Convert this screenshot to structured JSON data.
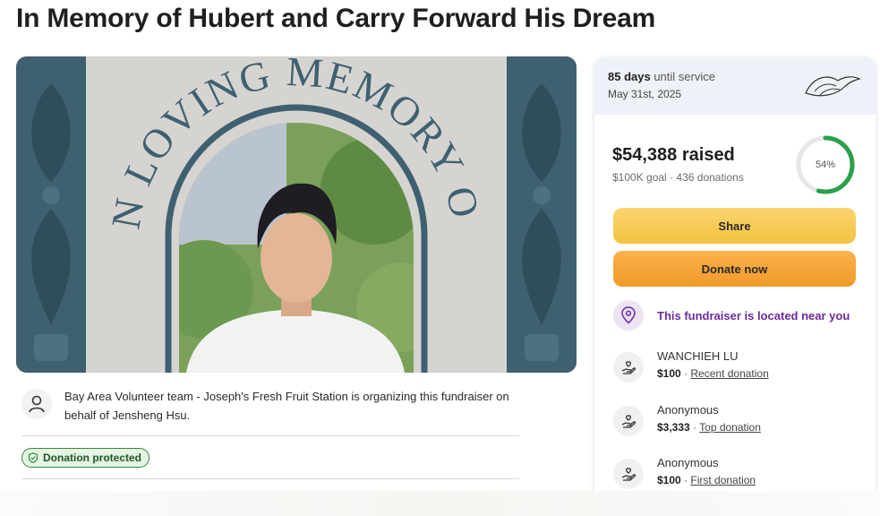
{
  "page": {
    "title": "In Memory of Hubert and Carry Forward His Dream"
  },
  "hero": {
    "arch_text": "IN LOVING MEMORY OF"
  },
  "organizer": {
    "text": "Bay Area Volunteer team - Joseph's Fresh Fruit Station is organizing this fundraiser on behalf of Jensheng Hsu."
  },
  "badge": {
    "label": "Donation protected"
  },
  "card": {
    "days": "85 days",
    "days_suffix": "until service",
    "date": "May 31st, 2025",
    "raised": "$54,388 raised",
    "goal": "$100K goal",
    "donations": "436 donations",
    "percent_label": "54%",
    "percent_value": 0.54,
    "share_label": "Share",
    "donate_label": "Donate now",
    "nearby_text": "This fundraiser is located near you"
  },
  "donations": [
    {
      "name": "WANCHIEH LU",
      "amount": "$100",
      "tag": "Recent donation"
    },
    {
      "name": "Anonymous",
      "amount": "$3,333",
      "tag": "Top donation"
    },
    {
      "name": "Anonymous",
      "amount": "$100",
      "tag": "First donation"
    }
  ],
  "colors": {
    "ring_green": "#2aa14a",
    "nearby_purple": "#6a2a9b",
    "share_yellow": "#f6c84b",
    "donate_orange": "#f4a236"
  }
}
